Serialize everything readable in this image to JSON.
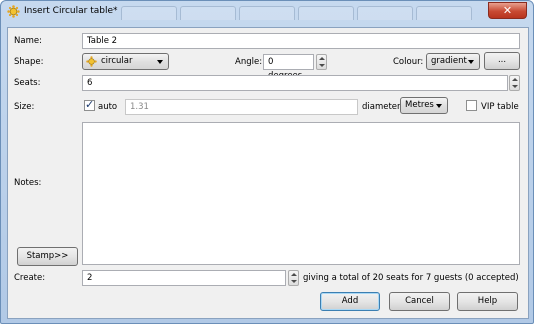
{
  "window": {
    "title": "Insert Circular table*",
    "close_label": "✕"
  },
  "form": {
    "name_label": "Name:",
    "name_value": "Table 2",
    "shape_label": "Shape:",
    "shape_value": "circular",
    "angle_label": "Angle:",
    "angle_value": "0 degrees",
    "colour_label": "Colour:",
    "colour_value": "gradient",
    "colour_more_label": "...",
    "seats_label": "Seats:",
    "seats_value": "6",
    "size_label": "Size:",
    "auto_label": "auto",
    "auto_checked": true,
    "size_value": "1.31",
    "diameter_label": "diameter",
    "units_value": "Metres",
    "vip_label": "VIP table",
    "vip_checked": false,
    "notes_label": "Notes:",
    "notes_value": "",
    "stamp_label": "Stamp>>",
    "create_label": "Create:",
    "create_value": "2",
    "summary_text": "giving a total of 20 seats for 7 guests (0 accepted)"
  },
  "buttons": {
    "add": "Add",
    "cancel": "Cancel",
    "help": "Help"
  },
  "colors": {
    "title_bar": "#b9cfea",
    "dialog_bg": "#f0f0f0",
    "close_button": "#c84a33",
    "default_button_border": "#3c7fb1"
  }
}
